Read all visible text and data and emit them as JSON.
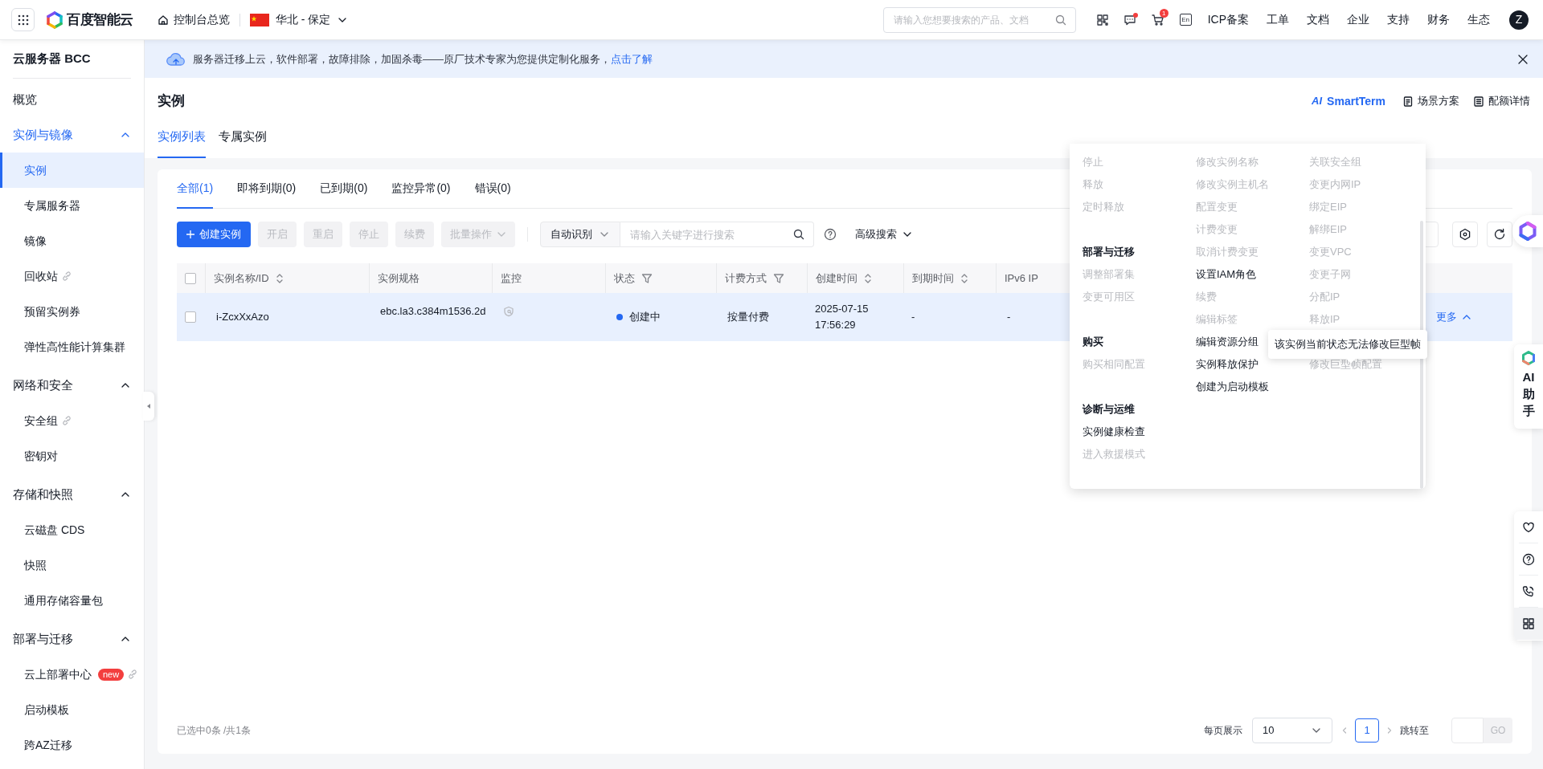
{
  "topbar": {
    "brand": "百度智能云",
    "console": "控制台总览",
    "region": "华北 - 保定",
    "search": {
      "placeholder": "请输入您想要搜索的产品、文档"
    },
    "message_unread": true,
    "cart_count": "1",
    "lang_icon": "En",
    "links": [
      "ICP备案",
      "工单",
      "文档",
      "企业",
      "支持",
      "财务",
      "生态"
    ],
    "avatar": "Z"
  },
  "banner": {
    "text": "服务器迁移上云，软件部署，故障排除，加固杀毒——原厂技术专家为您提供定制化服务，",
    "link": "点击了解"
  },
  "sidebar": {
    "title": "云服务器 BCC",
    "items": [
      {
        "label": "概览"
      },
      {
        "label": "实例与镜像",
        "expanded": true,
        "children": [
          {
            "label": "实例",
            "selected": true
          },
          {
            "label": "专属服务器",
            "selected": false
          },
          {
            "label": "镜像",
            "selected": false
          },
          {
            "label": "回收站",
            "selected": false,
            "link_icon": true
          },
          {
            "label": "预留实例券",
            "selected": false
          },
          {
            "label": "弹性高性能计算集群",
            "selected": false
          }
        ]
      },
      {
        "label": "网络和安全",
        "expanded": true,
        "children": [
          {
            "label": "安全组",
            "selected": false,
            "link_icon": true
          },
          {
            "label": "密钥对",
            "selected": false
          }
        ]
      },
      {
        "label": "存储和快照",
        "expanded": true,
        "children": [
          {
            "label": "云磁盘 CDS",
            "selected": false
          },
          {
            "label": "快照",
            "selected": false
          },
          {
            "label": "通用存储容量包",
            "selected": false
          }
        ]
      },
      {
        "label": "部署与迁移",
        "expanded": true,
        "children": [
          {
            "label": "云上部署中心",
            "selected": false,
            "badge": "new",
            "link_icon": true
          },
          {
            "label": "启动模板",
            "selected": false
          },
          {
            "label": "跨AZ迁移",
            "selected": false
          }
        ]
      }
    ]
  },
  "page": {
    "title": "实例",
    "smartterm": {
      "logo": "AI",
      "label": "SmartTerm"
    },
    "actions": [
      "场景方案",
      "配额详情"
    ]
  },
  "tabs": [
    {
      "label": "实例列表",
      "selected": true
    },
    {
      "label": "专属实例",
      "selected": false
    }
  ],
  "status_tabs": [
    {
      "label": "全部(1)",
      "selected": true
    },
    {
      "label": "即将到期(0)",
      "selected": false
    },
    {
      "label": "已到期(0)",
      "selected": false
    },
    {
      "label": "监控异常(0)",
      "selected": false
    },
    {
      "label": "错误(0)",
      "selected": false
    }
  ],
  "toolbar": {
    "buttons": [
      {
        "label": "创建实例",
        "kind": "primary",
        "disabled": false
      },
      {
        "label": "开启",
        "kind": "default",
        "disabled": true
      },
      {
        "label": "重启",
        "kind": "default",
        "disabled": true
      },
      {
        "label": "停止",
        "kind": "default",
        "disabled": true
      },
      {
        "label": "续费",
        "kind": "default",
        "disabled": true
      },
      {
        "label": "批量操作",
        "kind": "dropdown",
        "disabled": true
      }
    ],
    "search_field": "自动识别",
    "search_placeholder": "请输入关键字进行搜索",
    "advanced": "高级搜索"
  },
  "table": {
    "all_checked": false,
    "columns": [
      {
        "label": "实例名称/ID",
        "sortable": true,
        "filterable": false
      },
      {
        "label": "实例规格",
        "sortable": false,
        "filterable": false
      },
      {
        "label": "监控",
        "sortable": false,
        "filterable": false
      },
      {
        "label": "状态",
        "sortable": false,
        "filterable": true
      },
      {
        "label": "计费方式",
        "sortable": false,
        "filterable": true
      },
      {
        "label": "创建时间",
        "sortable": true,
        "filterable": false
      },
      {
        "label": "到期时间",
        "sortable": true,
        "filterable": false
      },
      {
        "label": "IPv6 IP",
        "sortable": false,
        "filterable": false
      }
    ],
    "rows": [
      {
        "checked": false,
        "highlighted": true,
        "name": "i-ZcxXxAzo",
        "spec": "ebc.la3.c384m1536.2d",
        "status": {
          "text": "创建中",
          "color": "#2468f2"
        },
        "billing": "按量付费",
        "created": "2025-07-15 17:56:29",
        "expires": "-",
        "ipv6": "-",
        "more": "更多"
      }
    ]
  },
  "menu": {
    "columns": [
      {
        "groups": [
          {
            "items": [
              {
                "label": "停止",
                "disabled": true
              },
              {
                "label": "释放",
                "disabled": true
              },
              {
                "label": "定时释放",
                "disabled": true
              }
            ]
          },
          {
            "header": "部署与迁移",
            "items": [
              {
                "label": "调整部署集",
                "disabled": true
              },
              {
                "label": "变更可用区",
                "disabled": true
              }
            ]
          },
          {
            "header": "购买",
            "items": [
              {
                "label": "购买相同配置",
                "disabled": true
              }
            ]
          },
          {
            "header": "诊断与运维",
            "items": [
              {
                "label": "实例健康检查",
                "disabled": false
              },
              {
                "label": "进入救援模式",
                "disabled": true
              }
            ]
          }
        ]
      },
      {
        "groups": [
          {
            "items": [
              {
                "label": "修改实例名称",
                "disabled": true
              },
              {
                "label": "修改实例主机名",
                "disabled": true
              },
              {
                "label": "配置变更",
                "disabled": true
              },
              {
                "label": "计费变更",
                "disabled": true
              },
              {
                "label": "取消计费变更",
                "disabled": true
              },
              {
                "label": "设置IAM角色",
                "disabled": false
              },
              {
                "label": "续费",
                "disabled": true
              },
              {
                "label": "编辑标签",
                "disabled": true
              },
              {
                "label": "编辑资源分组",
                "disabled": false
              },
              {
                "label": "实例释放保护",
                "disabled": false
              },
              {
                "label": "创建为启动模板",
                "disabled": false
              }
            ]
          }
        ]
      },
      {
        "groups": [
          {
            "items": [
              {
                "label": "关联安全组",
                "disabled": true
              },
              {
                "label": "变更内网IP",
                "disabled": true
              },
              {
                "label": "绑定EIP",
                "disabled": true
              },
              {
                "label": "解绑EIP",
                "disabled": true
              },
              {
                "label": "变更VPC",
                "disabled": true
              },
              {
                "label": "变更子网",
                "disabled": true
              },
              {
                "label": "分配IP",
                "disabled": true
              },
              {
                "label": "释放IP",
                "disabled": true
              }
            ]
          },
          {
            "items": [
              {
                "label": "修改巨型帧配置",
                "disabled": true
              }
            ]
          }
        ]
      }
    ]
  },
  "tooltip": "该实例当前状态无法修改巨型帧",
  "footer": {
    "summary": "已选中0条 /共1条",
    "page_size_label": "每页展示",
    "page_size": "10",
    "pages": [
      {
        "label": "1",
        "selected": true
      }
    ],
    "jump_label": "跳转至",
    "go": "GO"
  },
  "assistant": {
    "label": "AI助手"
  }
}
